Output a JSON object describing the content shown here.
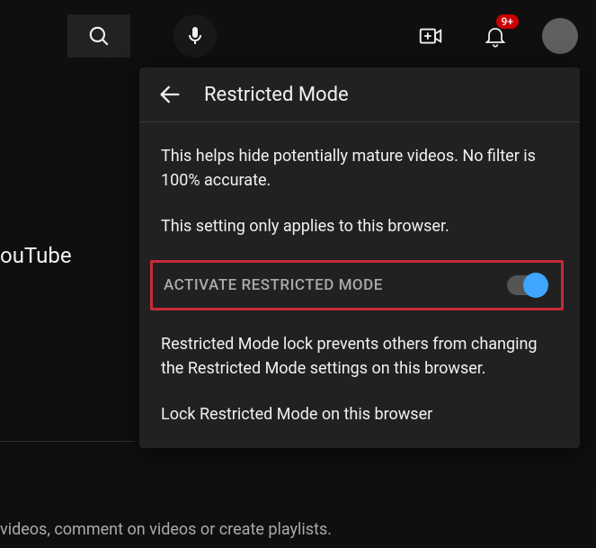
{
  "topbar": {
    "notification_count": "9+"
  },
  "sidebar": {
    "brand_partial": "ouTube"
  },
  "bottom": {
    "text_partial": "videos, comment on videos or create playlists."
  },
  "panel": {
    "title": "Restricted Mode",
    "info1": "This helps hide potentially mature videos. No filter is 100% accurate.",
    "info2": "This setting only applies to this browser.",
    "toggle_label": "ACTIVATE RESTRICTED MODE",
    "toggle_on": true,
    "info3": "Restricted Mode lock prevents others from changing the Restricted Mode settings on this browser.",
    "lock_link": "Lock Restricted Mode on this browser"
  }
}
